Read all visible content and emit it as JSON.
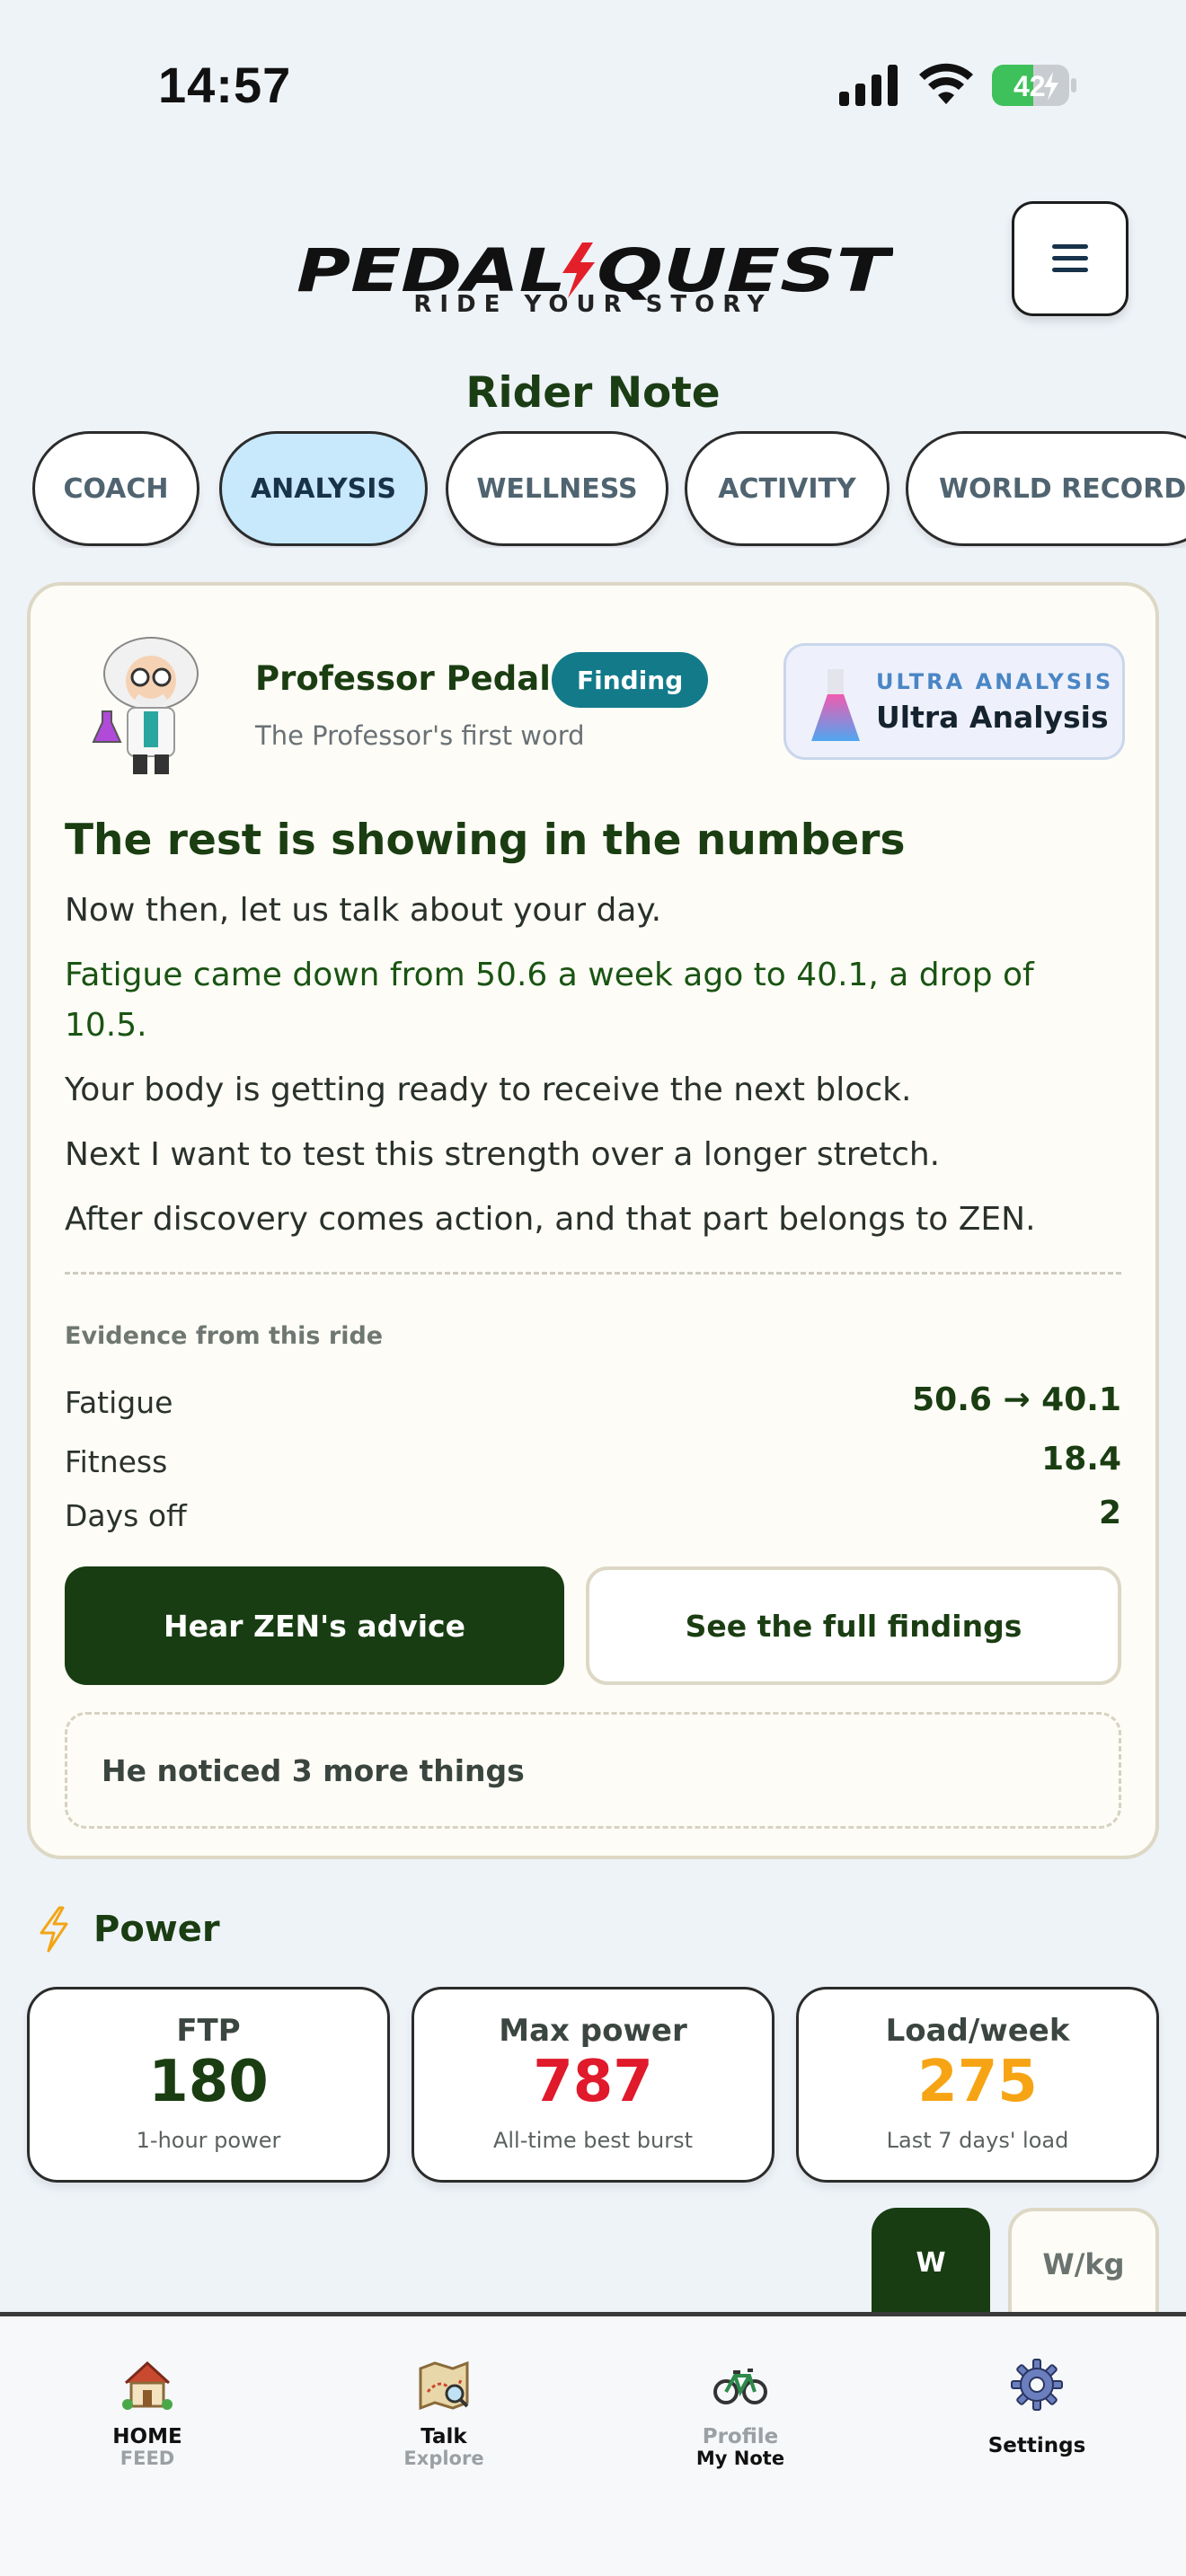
{
  "status_bar": {
    "time": "14:57",
    "battery": "42"
  },
  "header": {
    "brand": "PEDAL QUEST",
    "brand_left": "PEDAL",
    "brand_right": "QUEST",
    "tagline": "RIDE YOUR STORY",
    "page_title": "Rider Note"
  },
  "tabs": [
    {
      "label": "COACH",
      "active": false
    },
    {
      "label": "ANALYSIS",
      "active": true
    },
    {
      "label": "WELLNESS",
      "active": false
    },
    {
      "label": "ACTIVITY",
      "active": false
    },
    {
      "label": "WORLD RECORDS",
      "active": false
    }
  ],
  "analysis": {
    "author": "Professor Pedal",
    "badge": "Finding",
    "subtitle": "The Professor's first word",
    "ultra_kicker": "ULTRA ANALYSIS",
    "ultra_title": "Ultra Analysis",
    "headline": "The rest is showing in the numbers",
    "paragraphs": [
      "Now then, let us talk about your day.",
      "Fatigue came down from 50.6 a week ago to 40.1, a drop of 10.5.",
      "Your body is getting ready to receive the next block.",
      "Next I want to test this strength over a longer stretch.",
      "After discovery comes action, and that part belongs to ZEN."
    ],
    "evidence_title": "Evidence from this ride",
    "evidence": [
      {
        "label": "Fatigue",
        "value": "50.6 → 40.1"
      },
      {
        "label": "Fitness",
        "value": "18.4"
      },
      {
        "label": "Days off",
        "value": "2"
      }
    ],
    "primary_button": "Hear ZEN's advice",
    "secondary_button": "See the full findings",
    "more": "He noticed 3 more things"
  },
  "power": {
    "title": "Power",
    "metrics": [
      {
        "label": "FTP",
        "value": "180",
        "sub": "1-hour power",
        "color": "#1a3d12"
      },
      {
        "label": "Max power",
        "value": "787",
        "sub": "All-time best burst",
        "color": "#e0192b"
      },
      {
        "label": "Load/week",
        "value": "275",
        "sub": "Last 7 days' load",
        "color": "#f7a414"
      }
    ],
    "unit_w": "W",
    "unit_wkg": "W/kg"
  },
  "nav": [
    {
      "label": "HOME",
      "sub": "FEED"
    },
    {
      "label": "Talk",
      "sub": "Explore"
    },
    {
      "label": "Profile",
      "sub": "My Note"
    },
    {
      "label": "Settings",
      "sub": ""
    }
  ],
  "colors": {
    "brand_green": "#1a3d12",
    "accent_teal": "#137a8a",
    "active_tab": "#c8e8fb",
    "max_red": "#e0192b",
    "load_orange": "#f7a414"
  }
}
